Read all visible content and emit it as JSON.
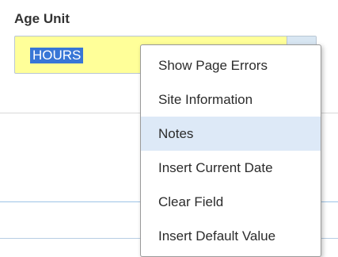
{
  "form": {
    "age_unit": {
      "label": "Age Unit",
      "value": "HOURS"
    }
  },
  "context_menu": {
    "items": [
      {
        "label": "Show Page Errors"
      },
      {
        "label": "Site Information"
      },
      {
        "label": "Notes",
        "highlighted": true
      },
      {
        "label": "Insert Current Date"
      },
      {
        "label": "Clear Field"
      },
      {
        "label": "Insert Default Value"
      }
    ]
  },
  "colors": {
    "input_background": "#ffff99",
    "selection": "#3876d6",
    "menu_highlight": "#dde9f7"
  }
}
